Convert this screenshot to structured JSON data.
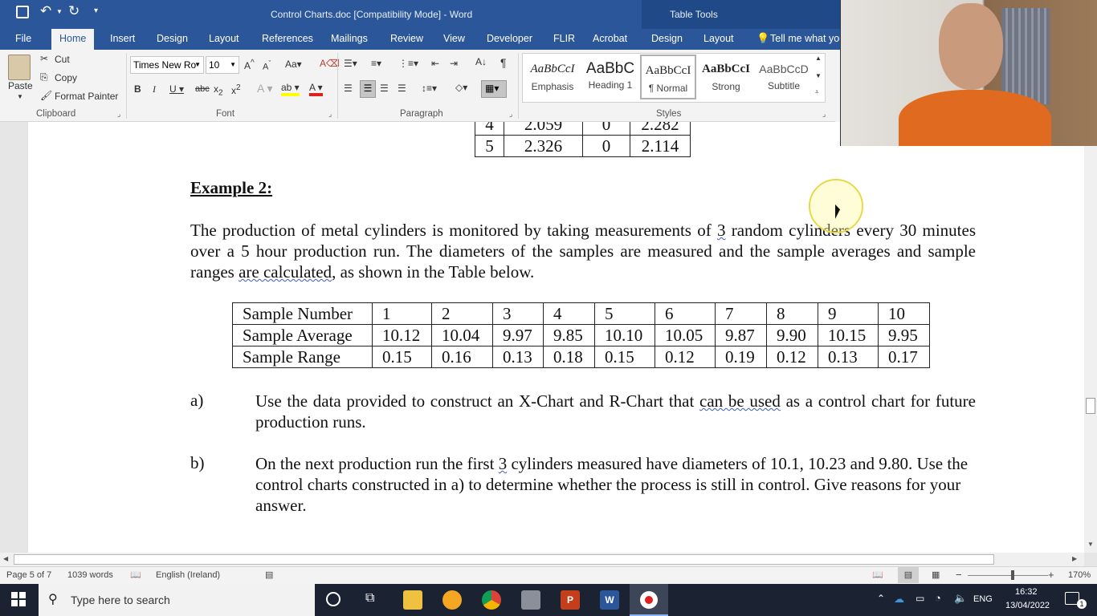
{
  "window": {
    "title": "Control Charts.doc [Compatibility Mode] - Word",
    "context_tab_group": "Table Tools"
  },
  "ribbon_tabs": [
    "File",
    "Home",
    "Insert",
    "Design",
    "Layout",
    "References",
    "Mailings",
    "Review",
    "View",
    "Developer",
    "FLIR",
    "Acrobat",
    "Design",
    "Layout"
  ],
  "tell_me": "Tell me what you",
  "clipboard": {
    "paste": "Paste",
    "cut": "Cut",
    "copy": "Copy",
    "format_painter": "Format Painter",
    "group_label": "Clipboard"
  },
  "font": {
    "name": "Times New Ro",
    "size": "10",
    "group_label": "Font"
  },
  "paragraph": {
    "group_label": "Paragraph"
  },
  "styles": {
    "group_label": "Styles",
    "items": [
      {
        "preview": "AaBbCcI",
        "name": "Emphasis"
      },
      {
        "preview": "AaBbC",
        "name": "Heading 1"
      },
      {
        "preview": "AaBbCcI",
        "name": "¶ Normal"
      },
      {
        "preview": "AaBbCcI",
        "name": "Strong"
      },
      {
        "preview": "AaBbCcD",
        "name": "Subtitle"
      }
    ]
  },
  "prev_table": {
    "rows": [
      [
        "4",
        "2.059",
        "0",
        "2.282"
      ],
      [
        "5",
        "2.326",
        "0",
        "2.114"
      ]
    ]
  },
  "heading": "Example 2:",
  "intro": {
    "part1": "The production of metal cylinders is monitored by taking measurements of ",
    "num": "3",
    "part2": " random cylinders every 30 minutes over a 5 hour production run. The diameters of the samples are measured and the sample averages and sample ranges ",
    "wavy": "are calculated",
    "part3": ", as shown in the Table below."
  },
  "data_table": {
    "rows": [
      [
        "Sample Number",
        "1",
        "2",
        "3",
        "4",
        "5",
        "6",
        "7",
        "8",
        "9",
        "10"
      ],
      [
        "Sample Average",
        "10.12",
        "10.04",
        "9.97",
        "9.85",
        "10.10",
        "10.05",
        "9.87",
        "9.90",
        "10.15",
        "9.95"
      ],
      [
        "Sample Range",
        "0.15",
        "0.16",
        "0.13",
        "0.18",
        "0.15",
        "0.12",
        "0.19",
        "0.12",
        "0.13",
        "0.17"
      ]
    ]
  },
  "questions": {
    "a_label": "a)",
    "a_part1": "Use the data provided to construct an X-Chart and R-Chart that ",
    "a_wavy": "can be used",
    "a_part2": " as a control chart for future production runs.",
    "b_label": "b)",
    "b_part1": "On the next production run the first ",
    "b_num": "3",
    "b_part2": " cylinders measured have diameters of 10.1, 10.23 and 9.80. Use the control charts constructed in a) to determine whether the process is still in control. Give reasons for your answer."
  },
  "status": {
    "page": "Page 5 of 7",
    "words": "1039 words",
    "language": "English (Ireland)",
    "zoom": "170%"
  },
  "taskbar": {
    "search_placeholder": "Type here to search",
    "lang": "ENG",
    "time": "16:32",
    "date": "13/04/2022",
    "notifications": "1"
  },
  "colors": {
    "word_blue": "#2b579a",
    "taskbar": "#1b2333"
  }
}
